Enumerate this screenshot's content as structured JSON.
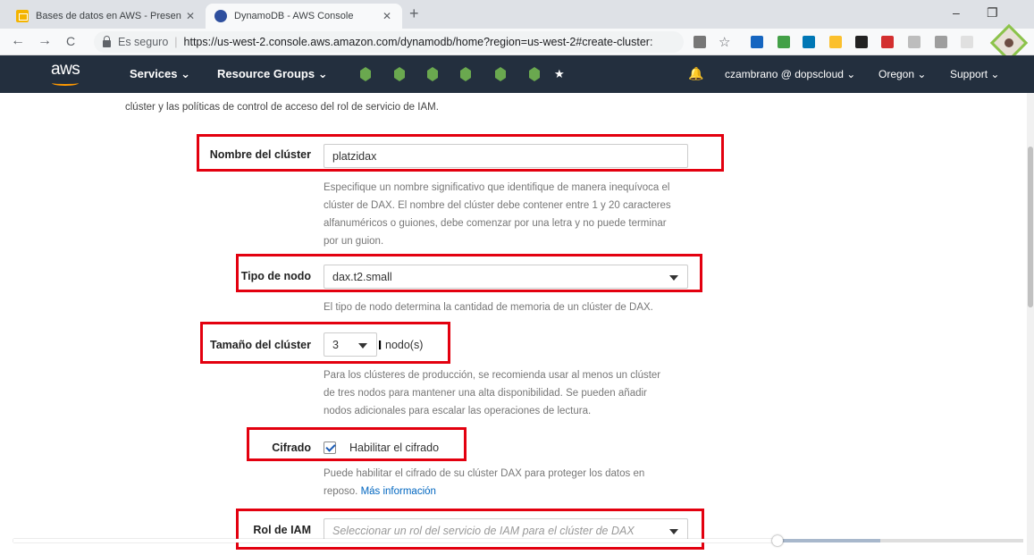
{
  "browser": {
    "tabs": [
      {
        "title": "Bases de datos en AWS - Presen",
        "active": false
      },
      {
        "title": "DynamoDB - AWS Console",
        "active": true
      }
    ],
    "url_secure_label": "Es seguro",
    "url": "https://us-west-2.console.aws.amazon.com/dynamodb/home?region=us-west-2#create-cluster:",
    "new_tab": "+",
    "tab_close": "✕",
    "minimize": "–",
    "restore": "❐",
    "back": "←",
    "forward": "→",
    "reload": "C",
    "bookmark_star": "☆"
  },
  "aws_nav": {
    "logo": "aws",
    "services": "Services ⌄",
    "resource_groups": "Resource Groups ⌄",
    "pin_star": "★",
    "bell": "🔔",
    "account": "czambrano @ dopscloud ⌄",
    "region": "Oregon ⌄",
    "support": "Support ⌄"
  },
  "form": {
    "intro": "clúster y las políticas de control de acceso del rol de servicio de IAM.",
    "cluster_name": {
      "label": "Nombre del clúster",
      "value": "platzidax",
      "help": [
        "Especifique un nombre significativo que identifique de manera inequívoca el",
        "clúster de DAX. El nombre del clúster debe contener entre 1 y 20 caracteres",
        "alfanuméricos o guiones, debe comenzar por una letra y no puede terminar",
        "por un guion."
      ]
    },
    "node_type": {
      "label": "Tipo de nodo",
      "value": "dax.t2.small",
      "help": "El tipo de nodo determina la cantidad de memoria de un clúster de DAX."
    },
    "cluster_size": {
      "label": "Tamaño del clúster",
      "value": "3",
      "suffix": "nodo(s)",
      "help": [
        "Para los clústeres de producción, se recomienda usar al menos un clúster",
        "de tres nodos para mantener una alta disponibilidad. Se pueden añadir",
        "nodos adicionales para escalar las operaciones de lectura."
      ]
    },
    "encryption": {
      "label": "Cifrado",
      "checkbox_label": "Habilitar el cifrado",
      "checked": true,
      "help_line1": "Puede habilitar el cifrado de su clúster DAX para proteger los datos en",
      "help_line2": "reposo.",
      "more_info": "Más información"
    },
    "iam_role": {
      "label": "Rol de IAM",
      "placeholder": "Seleccionar un rol del servicio de IAM para el clúster de DAX"
    }
  },
  "video": {
    "progress_fraction": 0.757
  },
  "colors": {
    "highlight": "#e3000f",
    "aws_nav_bg": "#232f3e",
    "aws_orange": "#ff9900",
    "link": "#0066c0"
  }
}
